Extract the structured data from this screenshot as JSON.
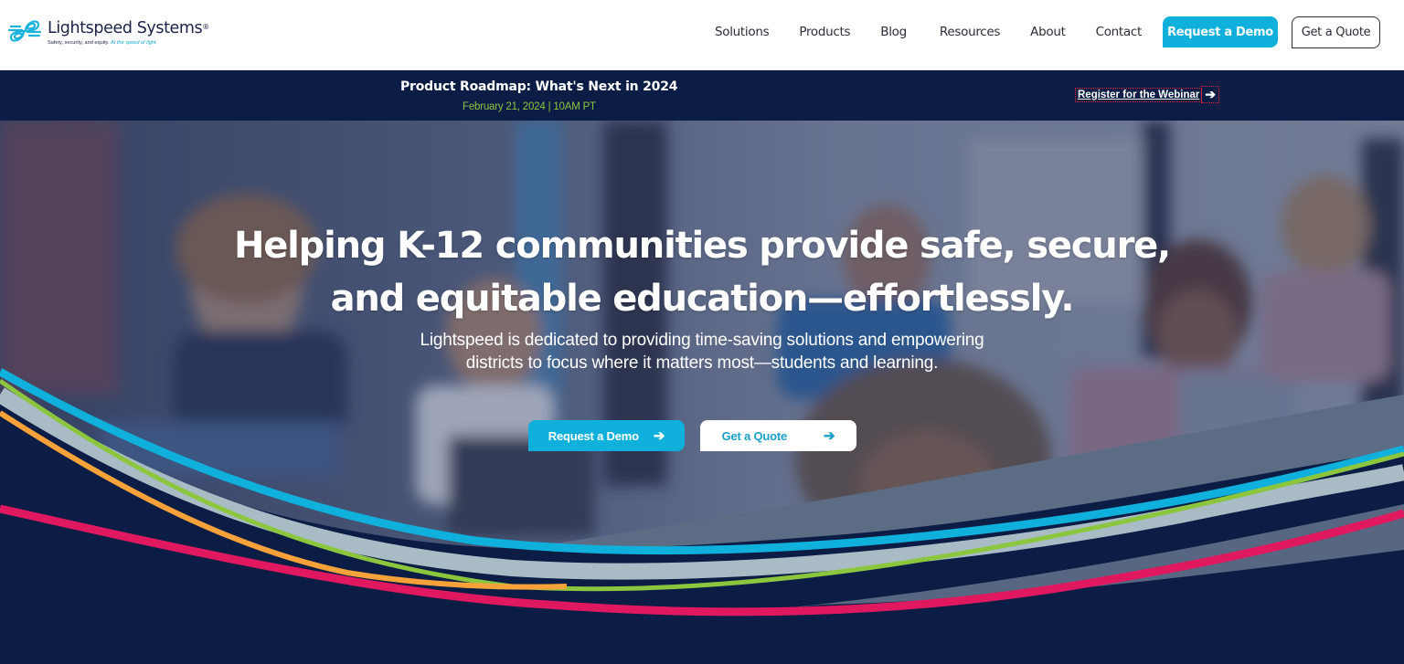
{
  "brand": {
    "name": "Lightspeed Systems",
    "registered_mark": "®",
    "tagline_main": "Safety, security, and equity.",
    "tagline_accent": "At the speed of light.",
    "primary_color": "#0fb0dc",
    "navy_color": "#0b1d45",
    "green_color": "#8cc63f"
  },
  "nav": {
    "items": [
      {
        "label": "Solutions"
      },
      {
        "label": "Products"
      },
      {
        "label": "Blog"
      },
      {
        "label": "Resources"
      },
      {
        "label": "About"
      },
      {
        "label": "Contact"
      }
    ],
    "request_demo_label": "Request a Demo",
    "get_quote_label": "Get a Quote"
  },
  "announcement": {
    "title": "Product Roadmap: What's Next in 2024",
    "date": "February 21, 2024 | 10AM PT",
    "register_label": "Register for the Webinar",
    "register_icon": "arrow-right-icon",
    "arrow_glyph": "➔"
  },
  "hero": {
    "title_line1": "Helping K-12 communities provide safe, secure,",
    "title_line2": "and equitable education—effortlessly.",
    "subtitle_line1": "Lightspeed is dedicated to providing time-saving solutions and empowering",
    "subtitle_line2": "districts to focus where it matters most—students and learning.",
    "request_demo_label": "Request a Demo",
    "get_quote_label": "Get a Quote",
    "arrow_glyph": "➔",
    "wave_colors": {
      "cyan": "#0fb0dc",
      "silver": "#a9bcc6",
      "green": "#8cc63f",
      "orange": "#f7a13a",
      "pink": "#e0185f",
      "slate": "#5d6c85",
      "navy": "#0b1d45"
    }
  }
}
